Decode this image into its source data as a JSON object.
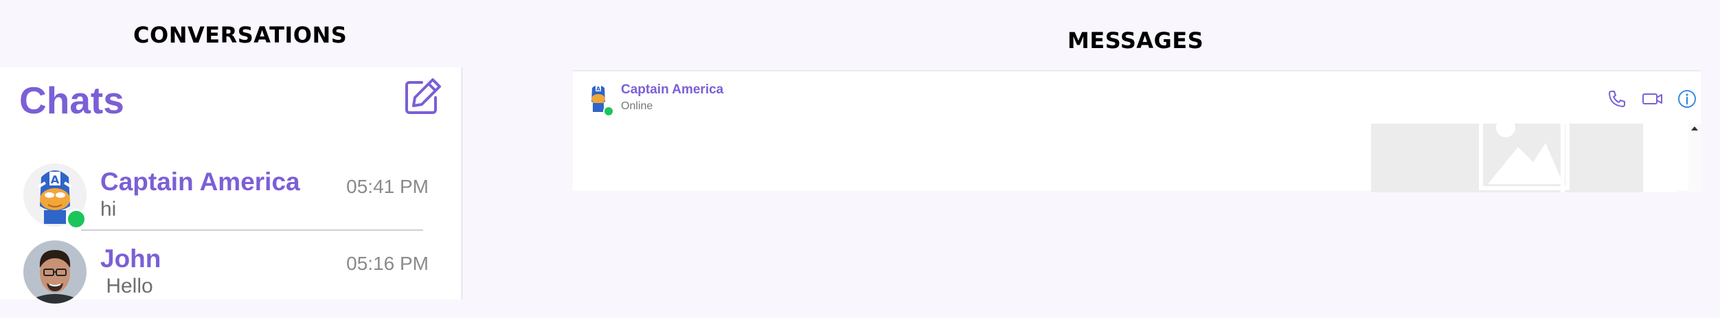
{
  "sections": {
    "conversations_title": "CONVERSATIONS",
    "messages_title": "MESSAGES"
  },
  "chats": {
    "heading": "Chats",
    "compose_icon": "edit-square-icon",
    "items": [
      {
        "name": "Captain America",
        "preview": "hi",
        "time": "05:41 PM",
        "online": true
      },
      {
        "name": "John",
        "preview": " Hello",
        "time": "05:16 PM",
        "online": false
      }
    ]
  },
  "messages": {
    "contact_name": "Captain America",
    "contact_status": "Online",
    "icons": [
      "phone-icon",
      "video-icon",
      "info-icon"
    ]
  },
  "colors": {
    "accent": "#7b5fd6",
    "online": "#1ac65b",
    "info_blue": "#3a8be0",
    "background": "#f9f7fd"
  }
}
